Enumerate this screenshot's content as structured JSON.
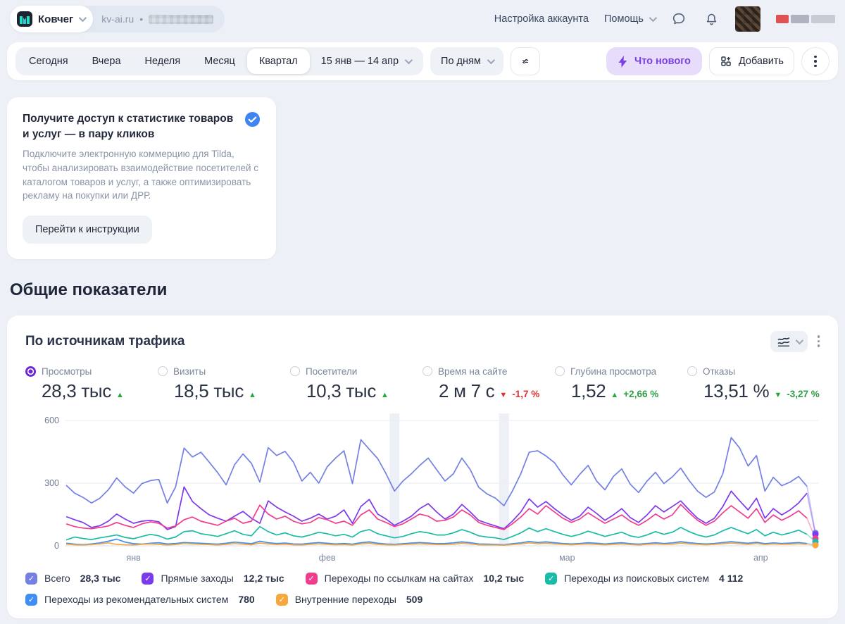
{
  "header": {
    "counter_name": "Ковчег",
    "counter_domain": "kv-ai.ru",
    "separator": "•",
    "account_settings": "Настройка аккаунта",
    "help": "Помощь"
  },
  "toolbar": {
    "periods": [
      "Сегодня",
      "Вчера",
      "Неделя",
      "Месяц",
      "Квартал"
    ],
    "active_period": "Квартал",
    "date_range": "15 янв — 14 апр",
    "granularity": "По дням",
    "whats_new": "Что нового",
    "add": "Добавить"
  },
  "promo": {
    "title": "Получите доступ к статистике товаров и услуг — в пару кликов",
    "body": "Подключите электронную коммерцию для Tilda, чтобы анализировать взаимодействие посетителей с каталогом товаров и услуг, а также оптимизировать рекламу на покупки или ДРР.",
    "button": "Перейти к инструкции"
  },
  "section_title": "Общие показатели",
  "chart_card": {
    "title": "По источникам трафика",
    "metrics": [
      {
        "label": "Просмотры",
        "value": "28,3 тыс",
        "arrow": "up",
        "arrow_color": "#27a93c",
        "delta": "",
        "delta_color": "#27a93c",
        "selected": true
      },
      {
        "label": "Визиты",
        "value": "18,5 тыс",
        "arrow": "up",
        "arrow_color": "#27a93c",
        "delta": "",
        "delta_color": "#27a93c",
        "selected": false
      },
      {
        "label": "Посетители",
        "value": "10,3 тыс",
        "arrow": "up",
        "arrow_color": "#27a93c",
        "delta": "",
        "delta_color": "#27a93c",
        "selected": false
      },
      {
        "label": "Время на сайте",
        "value": "2 м 7 с",
        "arrow": "down",
        "arrow_color": "#e03131",
        "delta": "-1,7 %",
        "delta_color": "#e03131",
        "selected": false
      },
      {
        "label": "Глубина просмотра",
        "value": "1,52",
        "arrow": "up",
        "arrow_color": "#27a93c",
        "delta": "+2,66 %",
        "delta_color": "#2f9e44",
        "selected": false
      },
      {
        "label": "Отказы",
        "value": "13,51 %",
        "arrow": "down",
        "arrow_color": "#27a93c",
        "delta": "-3,27 %",
        "delta_color": "#2f9e44",
        "selected": false
      }
    ]
  },
  "chart_data": {
    "type": "line",
    "title": "По источникам трафика",
    "x_unit": "day",
    "x_range_label": "15 янв — 14 апр",
    "ylim": [
      0,
      600
    ],
    "yticks": [
      0,
      300,
      600
    ],
    "grid": true,
    "month_labels": [
      {
        "label": "янв",
        "day": 8
      },
      {
        "label": "фев",
        "day": 31
      },
      {
        "label": "мар",
        "day": 59.5
      },
      {
        "label": "апр",
        "day": 82.5
      }
    ],
    "holiday_bands_days": [
      39,
      52
    ],
    "series": [
      {
        "name": "Всего",
        "total": "28,3 тыс",
        "color": "#7480e4",
        "values": [
          290,
          252,
          232,
          205,
          228,
          268,
          325,
          282,
          252,
          298,
          312,
          318,
          205,
          282,
          468,
          425,
          448,
          400,
          350,
          292,
          388,
          440,
          395,
          305,
          470,
          432,
          452,
          400,
          310,
          352,
          300,
          378,
          420,
          455,
          298,
          508,
          462,
          418,
          345,
          262,
          310,
          345,
          385,
          420,
          365,
          310,
          345,
          420,
          365,
          280,
          248,
          228,
          192,
          262,
          345,
          448,
          455,
          430,
          398,
          340,
          292,
          342,
          385,
          310,
          268,
          332,
          368,
          295,
          255,
          310,
          352,
          298,
          330,
          372,
          312,
          262,
          232,
          258,
          345,
          518,
          468,
          382,
          432,
          262,
          328,
          288,
          305,
          332,
          285,
          62
        ]
      },
      {
        "name": "Прямые заходы",
        "total": "12,2 тыс",
        "color": "#7c3aed",
        "values": [
          140,
          125,
          112,
          88,
          96,
          118,
          152,
          128,
          108,
          118,
          122,
          115,
          78,
          92,
          282,
          212,
          178,
          148,
          132,
          118,
          142,
          165,
          132,
          108,
          215,
          185,
          162,
          142,
          118,
          132,
          152,
          128,
          142,
          172,
          108,
          188,
          222,
          152,
          128,
          98,
          118,
          142,
          178,
          202,
          162,
          128,
          152,
          198,
          162,
          122,
          108,
          95,
          82,
          118,
          162,
          225,
          185,
          212,
          178,
          148,
          122,
          142,
          185,
          155,
          122,
          148,
          178,
          135,
          112,
          148,
          192,
          162,
          188,
          215,
          172,
          132,
          108,
          132,
          188,
          262,
          215,
          172,
          228,
          132,
          178,
          148,
          172,
          205,
          252,
          55
        ]
      },
      {
        "name": "Переходы по ссылкам на сайтах",
        "total": "10,2 тыс",
        "color": "#f03d8d",
        "values": [
          105,
          92,
          85,
          82,
          88,
          95,
          112,
          98,
          88,
          105,
          115,
          108,
          85,
          95,
          125,
          138,
          118,
          108,
          98,
          118,
          132,
          108,
          118,
          195,
          152,
          128,
          142,
          118,
          105,
          112,
          135,
          125,
          108,
          118,
          98,
          148,
          172,
          128,
          112,
          92,
          105,
          128,
          152,
          142,
          118,
          122,
          138,
          172,
          148,
          112,
          98,
          88,
          78,
          105,
          138,
          178,
          152,
          192,
          162,
          132,
          112,
          128,
          158,
          132,
          108,
          128,
          148,
          118,
          98,
          122,
          152,
          128,
          148,
          198,
          158,
          122,
          98,
          118,
          158,
          192,
          162,
          132,
          178,
          112,
          148,
          122,
          142,
          168,
          132,
          35
        ]
      },
      {
        "name": "Переходы из поисковых систем",
        "total": "4 112",
        "color": "#19bca6",
        "values": [
          28,
          42,
          35,
          30,
          38,
          45,
          52,
          40,
          34,
          45,
          55,
          48,
          32,
          42,
          68,
          72,
          58,
          52,
          45,
          58,
          72,
          55,
          48,
          92,
          68,
          52,
          62,
          48,
          42,
          52,
          65,
          58,
          48,
          55,
          42,
          68,
          78,
          58,
          48,
          38,
          45,
          58,
          68,
          62,
          52,
          52,
          62,
          78,
          65,
          48,
          42,
          38,
          30,
          45,
          62,
          85,
          68,
          82,
          68,
          55,
          45,
          55,
          70,
          58,
          45,
          55,
          65,
          48,
          40,
          52,
          68,
          55,
          65,
          88,
          68,
          52,
          42,
          52,
          72,
          88,
          72,
          58,
          78,
          48,
          65,
          52,
          62,
          75,
          55,
          20
        ]
      },
      {
        "name": "Переходы из рекомендательных систем",
        "total": "780",
        "color": "#3f8df5",
        "values": [
          12,
          8,
          6,
          9,
          14,
          22,
          32,
          18,
          10,
          8,
          12,
          15,
          9,
          11,
          16,
          14,
          12,
          10,
          8,
          12,
          18,
          14,
          10,
          22,
          15,
          11,
          13,
          9,
          8,
          12,
          16,
          12,
          9,
          11,
          8,
          15,
          19,
          12,
          9,
          7,
          10,
          13,
          16,
          13,
          10,
          11,
          14,
          19,
          15,
          9,
          8,
          7,
          5,
          10,
          14,
          21,
          16,
          19,
          15,
          11,
          9,
          11,
          15,
          12,
          9,
          12,
          15,
          10,
          8,
          11,
          15,
          11,
          14,
          20,
          15,
          11,
          9,
          11,
          16,
          20,
          16,
          12,
          17,
          10,
          14,
          11,
          13,
          16,
          11,
          5
        ]
      },
      {
        "name": "Внутренние переходы",
        "total": "509",
        "color": "#f6a83c",
        "values": [
          8,
          5,
          4,
          6,
          9,
          14,
          7,
          5,
          4,
          7,
          9,
          7,
          4,
          6,
          11,
          9,
          7,
          6,
          4,
          7,
          11,
          8,
          5,
          13,
          9,
          6,
          8,
          5,
          4,
          7,
          10,
          7,
          5,
          6,
          4,
          9,
          12,
          7,
          5,
          4,
          6,
          8,
          10,
          8,
          6,
          6,
          8,
          12,
          9,
          5,
          4,
          4,
          3,
          6,
          9,
          14,
          10,
          12,
          9,
          7,
          5,
          7,
          9,
          7,
          5,
          7,
          9,
          6,
          4,
          7,
          9,
          7,
          8,
          13,
          9,
          7,
          5,
          7,
          10,
          13,
          10,
          7,
          11,
          6,
          9,
          7,
          8,
          10,
          7,
          3
        ]
      }
    ]
  }
}
